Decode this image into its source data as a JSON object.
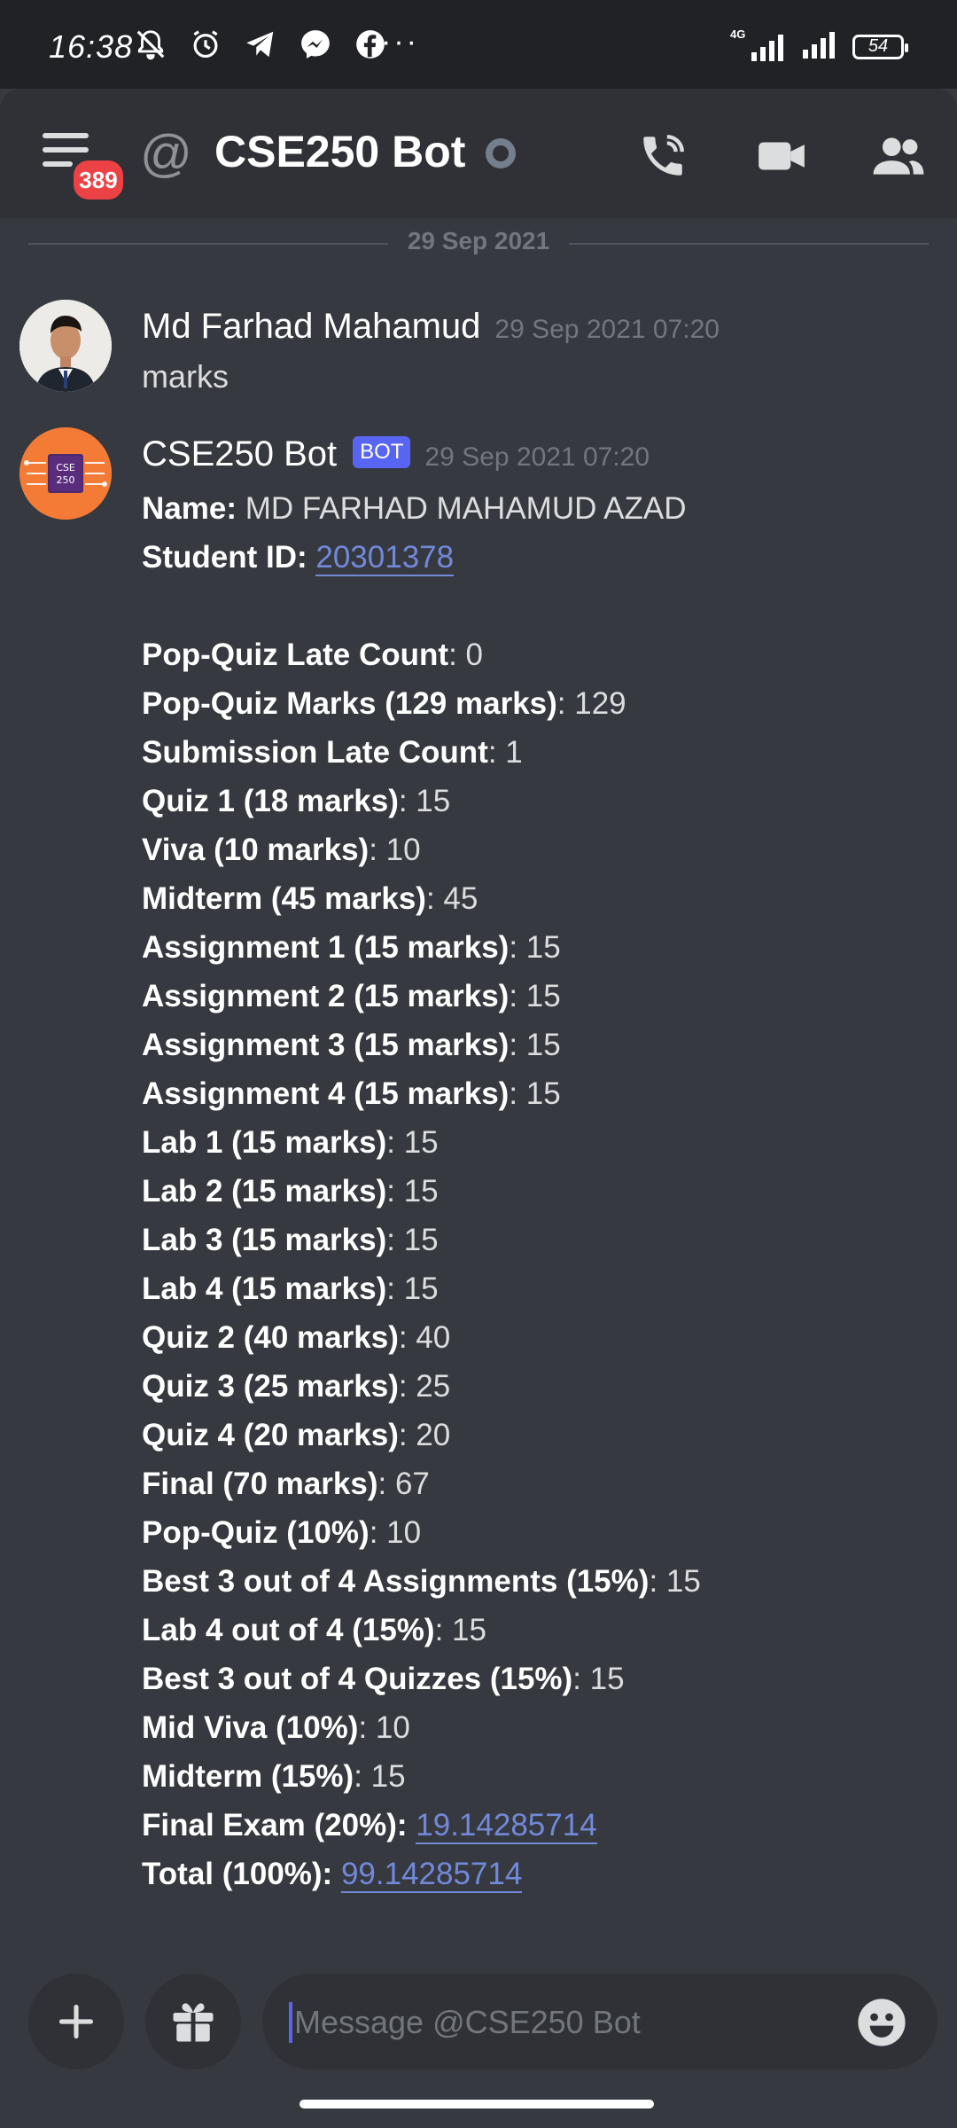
{
  "status_bar": {
    "time": "16:38",
    "network": "4G",
    "battery": "54",
    "more": "···"
  },
  "header": {
    "menu_badge": "389",
    "at_symbol": "@",
    "title": "CSE250 Bot",
    "icons": [
      "menu-icon",
      "phone-call-icon",
      "video-camera-icon",
      "members-icon"
    ]
  },
  "date_divider": "29 Sep 2021",
  "messages": [
    {
      "author": "Md Farhad Mahamud",
      "timestamp": "29 Sep 2021 07:20",
      "text": "marks"
    },
    {
      "author": "CSE250 Bot",
      "bot_tag": "BOT",
      "timestamp": "29 Sep 2021 07:20",
      "avatar_text": [
        "CSE",
        "250"
      ],
      "lines": [
        {
          "label": "Name:",
          "value": " MD FARHAD MAHAMUD AZAD"
        },
        {
          "label": "Student ID:",
          "value": "20301378",
          "link": true
        },
        {
          "blank": true
        },
        {
          "label": "Pop-Quiz Late Count",
          "value": ": 0"
        },
        {
          "label": "Pop-Quiz Marks (129 marks)",
          "value": ": 129"
        },
        {
          "label": "Submission Late Count",
          "value": ": 1"
        },
        {
          "label": "Quiz 1 (18 marks)",
          "value": ": 15"
        },
        {
          "label": "Viva (10 marks)",
          "value": ": 10"
        },
        {
          "label": "Midterm (45 marks)",
          "value": ": 45"
        },
        {
          "label": "Assignment 1 (15 marks)",
          "value": ": 15"
        },
        {
          "label": "Assignment 2 (15 marks)",
          "value": ": 15"
        },
        {
          "label": "Assignment 3 (15 marks)",
          "value": ": 15"
        },
        {
          "label": "Assignment 4 (15 marks)",
          "value": ": 15"
        },
        {
          "label": "Lab 1 (15 marks)",
          "value": ": 15"
        },
        {
          "label": "Lab 2 (15 marks)",
          "value": ": 15"
        },
        {
          "label": "Lab 3 (15 marks)",
          "value": ": 15"
        },
        {
          "label": "Lab 4 (15 marks)",
          "value": ": 15"
        },
        {
          "label": "Quiz 2 (40 marks)",
          "value": ": 40"
        },
        {
          "label": "Quiz 3 (25 marks)",
          "value": ": 25"
        },
        {
          "label": "Quiz 4 (20 marks)",
          "value": ": 20"
        },
        {
          "label": "Final (70 marks)",
          "value": ": 67"
        },
        {
          "label": "Pop-Quiz (10%)",
          "value": ": 10"
        },
        {
          "label": "Best 3 out of 4 Assignments (15%)",
          "value": ": 15"
        },
        {
          "label": "Lab 4 out of 4 (15%)",
          "value": ": 15"
        },
        {
          "label": "Best 3 out of 4 Quizzes (15%)",
          "value": ": 15"
        },
        {
          "label": "Mid Viva (10%)",
          "value": ": 10"
        },
        {
          "label": "Midterm (15%)",
          "value": ": 15"
        },
        {
          "label": "Final Exam (20%):",
          "value": "19.14285714",
          "link": true
        },
        {
          "label": "Total (100%):",
          "value": "99.14285714",
          "link": true
        }
      ]
    }
  ],
  "composer": {
    "placeholder": "Message @CSE250 Bot",
    "icons": [
      "plus-icon",
      "gift-icon",
      "emoji-icon"
    ]
  },
  "colors": {
    "background": "#36393f",
    "header": "#2f3136",
    "accent": "#5865f2",
    "link": "#7289da",
    "badge": "#ed4245",
    "bot_avatar": "#f47b36"
  }
}
